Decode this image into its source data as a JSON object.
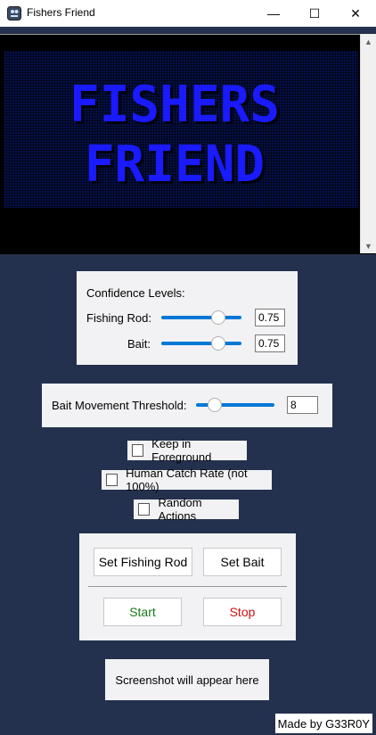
{
  "window": {
    "title": "Fishers Friend",
    "minimize_glyph": "—",
    "maximize_glyph": "☐",
    "close_glyph": "✕"
  },
  "banner": {
    "line1": "FISHERS",
    "line2": "FRIEND",
    "text_color": "#1a1aff",
    "bg_color": "#05104a"
  },
  "scroll": {
    "up": "▲",
    "down": "▼"
  },
  "confidence": {
    "heading": "Confidence Levels:",
    "rod_label": "Fishing Rod:",
    "rod_value": "0.75",
    "bait_label": "Bait:",
    "bait_value": "0.75"
  },
  "threshold": {
    "label": "Bait Movement Threshold:",
    "value": "8"
  },
  "options": {
    "foreground": "Keep in Foreground",
    "human_rate": "Human Catch Rate (not 100%)",
    "random_actions": "Random Actions"
  },
  "controls": {
    "set_rod": "Set Fishing Rod",
    "set_bait": "Set Bait",
    "start": "Start",
    "stop": "Stop",
    "start_color": "#1a7a1a",
    "stop_color": "#d01010"
  },
  "screenshot": {
    "placeholder": "Screenshot will appear here"
  },
  "footer": {
    "credit": "Made by G33R0Y"
  },
  "colors": {
    "background": "#24314e",
    "accent": "#0078d7"
  }
}
